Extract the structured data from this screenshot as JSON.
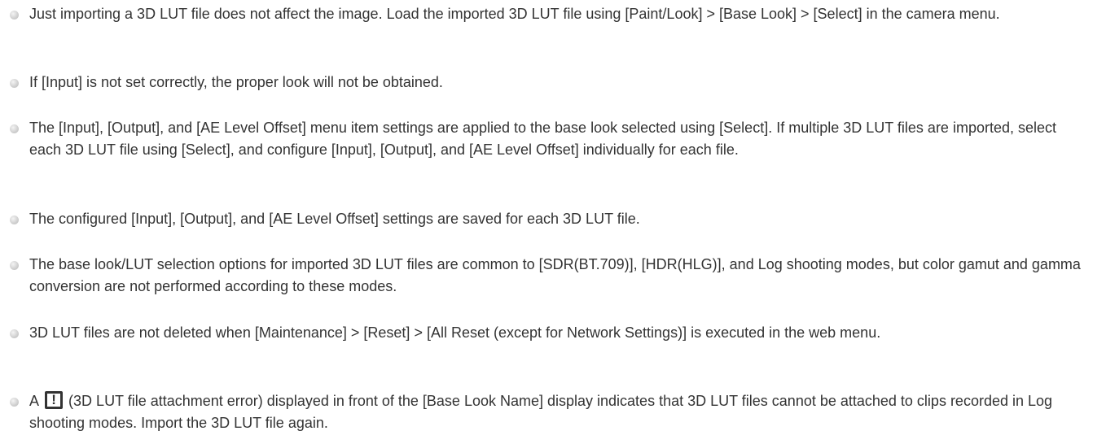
{
  "notes": [
    "Just importing a 3D LUT file does not affect the image. Load the imported 3D LUT file using [Paint/Look] > [Base Look] > [Select] in the camera menu.",
    "If [Input] is not set correctly, the proper look will not be obtained.",
    "The [Input], [Output], and [AE Level Offset] menu item settings are applied to the base look selected using [Select]. If multiple 3D LUT files are imported, select each 3D LUT file using [Select], and configure [Input], [Output], and [AE Level Offset] individually for each file.",
    "The configured [Input], [Output], and [AE Level Offset] settings are saved for each 3D LUT file.",
    "The base look/LUT selection options for imported 3D LUT files are common to [SDR(BT.709)], [HDR(HLG)], and Log shooting modes, but color gamut and gamma conversion are not performed according to these modes.",
    "3D LUT files are not deleted when [Maintenance] > [Reset] > [All Reset (except for Network Settings)] is executed in the web menu."
  ],
  "last_note": {
    "prefix": "A",
    "icon_text": "!",
    "icon_name": "lut-attachment-error-icon",
    "suffix": "(3D LUT file attachment error) displayed in front of the [Base Look Name] display indicates that 3D LUT files cannot be attached to clips recorded in Log shooting modes. Import the 3D LUT file again."
  }
}
